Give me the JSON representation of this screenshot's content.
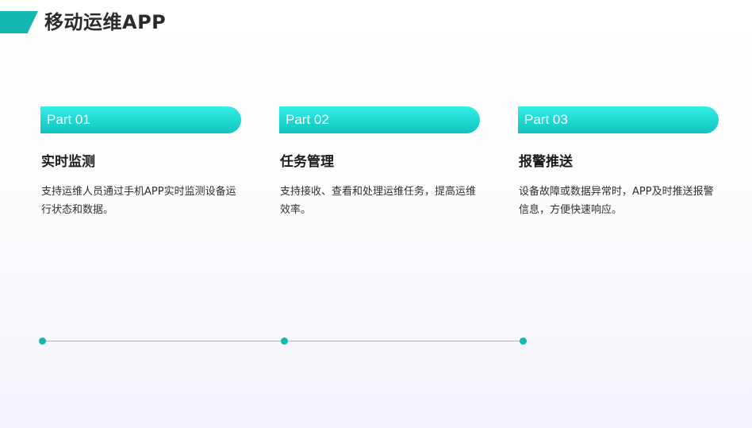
{
  "header": {
    "title": "移动运维APP"
  },
  "cards": [
    {
      "part_label": "Part 01",
      "title": "实时监测",
      "description": "支持运维人员通过手机APP实时监测设备运行状态和数据。"
    },
    {
      "part_label": "Part 02",
      "title": "任务管理",
      "description": "支持接收、查看和处理运维任务，提高运维效率。"
    },
    {
      "part_label": "Part 03",
      "title": "报警推送",
      "description": "设备故障或数据异常时，APP及时推送报警信息，方便快速响应。"
    }
  ],
  "colors": {
    "accent": "#14b8b2",
    "pill_top": "#34eee8",
    "pill_bottom": "#0fc4bd",
    "timeline": "#5fd9d4"
  }
}
